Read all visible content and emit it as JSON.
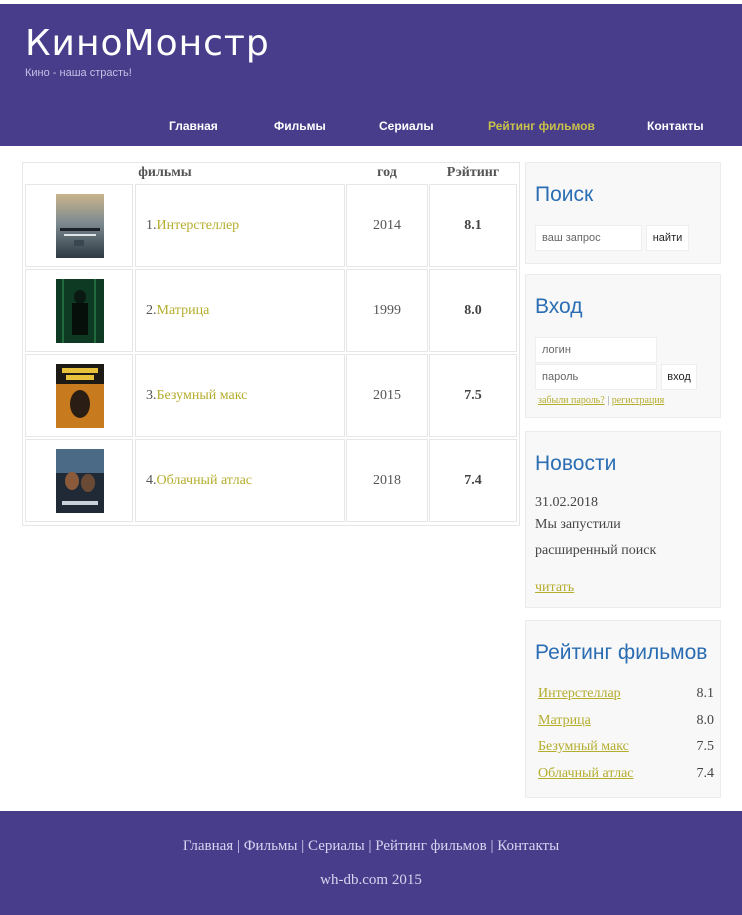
{
  "site": {
    "title": "КиноМонстр",
    "tagline": "Кино - наша страсть!"
  },
  "nav": [
    "Главная",
    "Фильмы",
    "Сериалы",
    "Рейтинг фильмов",
    "Контакты"
  ],
  "table": {
    "headers": {
      "film": "фильмы",
      "year": "год",
      "rating": "Рэйтинг"
    },
    "rows": [
      {
        "num": "1.",
        "title": "Интерстеллер",
        "year": "2014",
        "rating": "8.1"
      },
      {
        "num": "2.",
        "title": "Матрица",
        "year": "1999",
        "rating": "8.0"
      },
      {
        "num": "3.",
        "title": "Безумный макс",
        "year": "2015",
        "rating": "7.5"
      },
      {
        "num": "4.",
        "title": "Облачный атлас",
        "year": "2018",
        "rating": "7.4"
      }
    ]
  },
  "search": {
    "title": "Поиск",
    "placeholder": "ваш запрос",
    "button": "найти"
  },
  "login": {
    "title": "Вход",
    "login_placeholder": "логин",
    "password_placeholder": "пароль",
    "button": "вход",
    "forgot": "забыли пароль?",
    "separator": "|",
    "register": "регистрация"
  },
  "news": {
    "title": "Новости",
    "date": "31.02.2018",
    "line1": "Мы запустили",
    "line2": "расширенный поиск",
    "read": "читать"
  },
  "rating_box": {
    "title": "Рейтинг фильмов",
    "items": [
      {
        "name": "Интерстеллар",
        "value": "8.1"
      },
      {
        "name": "Матрица",
        "value": "8.0"
      },
      {
        "name": "Безумный макс",
        "value": "7.5"
      },
      {
        "name": "Облачный атлас",
        "value": "7.4"
      }
    ]
  },
  "footer": {
    "links": [
      "Главная",
      "Фильмы",
      "Сериалы",
      "Рейтинг фильмов",
      "Контакты"
    ],
    "separator": " | ",
    "copyright": "wh-db.com 2015"
  },
  "colors": {
    "brand": "#483D8B",
    "accent_link": "#b5ad2e",
    "heading_blue": "#2a6db3"
  }
}
